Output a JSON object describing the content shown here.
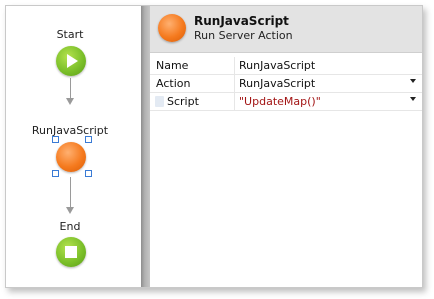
{
  "flow": {
    "start_label": "Start",
    "action_label": "RunJavaScript",
    "end_label": "End"
  },
  "properties": {
    "title": "RunJavaScript",
    "subtitle": "Run Server Action",
    "rows": [
      {
        "name": "Name",
        "value": "RunJavaScript",
        "dropdown": false
      },
      {
        "name": "Action",
        "value": "RunJavaScript",
        "dropdown": true
      },
      {
        "name": "Script",
        "value": "\"UpdateMap()\"",
        "dropdown": true
      }
    ]
  },
  "icons": {
    "start": "play-icon",
    "action": "server-action-icon",
    "end": "stop-icon"
  },
  "colors": {
    "start_end_green": "#7cc02a",
    "action_orange": "#f57a1e",
    "expression_red": "#a31515"
  }
}
